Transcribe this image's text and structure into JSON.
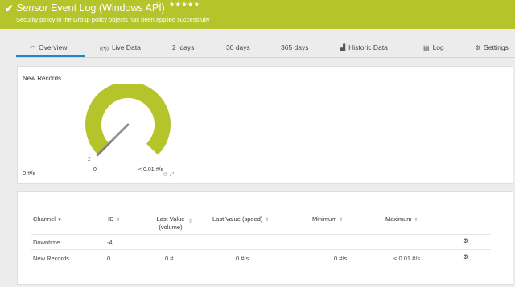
{
  "header": {
    "check_icon": "checkmark-icon",
    "kind": "Sensor",
    "name": "Event Log (Windows API)",
    "flag_icon": "flag-icon",
    "stars": "★★★★★",
    "message": "Security policy in the Group policy objects has been applied successfully",
    "color": "#b4c42a"
  },
  "tabs": [
    {
      "label": "Overview",
      "icon": "overview-gauge-icon",
      "glyph": "◠"
    },
    {
      "label": "Live Data",
      "icon": "live-data-icon",
      "glyph": "((•))"
    },
    {
      "label": "2  days"
    },
    {
      "label": "30 days"
    },
    {
      "label": "365 days"
    },
    {
      "label": "Historic Data",
      "icon": "chart-icon",
      "glyph": "▟"
    },
    {
      "label": "Log",
      "icon": "log-icon",
      "glyph": "▤"
    },
    {
      "label": "Settings",
      "icon": "gear-icon",
      "glyph": "⚙"
    }
  ],
  "active_tab": "Overview",
  "gauge": {
    "title": "New Records",
    "min_label": "0",
    "max_label": "< 0.01 #/s",
    "current_value": "0 #/s",
    "needle_fraction": 0.0,
    "color": "#b4c42a"
  },
  "table": {
    "headers": {
      "channel": "Channel",
      "id": "ID",
      "last_value_volume_1": "Last Value",
      "last_value_volume_2": "(volume)",
      "last_value_speed": "Last Value (speed)",
      "minimum": "Minimum",
      "maximum": "Maximum"
    },
    "rows": [
      {
        "channel": "Downtime",
        "id": "-4",
        "volume": "",
        "speed": "",
        "minimum": "",
        "maximum": ""
      },
      {
        "channel": "New Records",
        "id": "0",
        "volume": "0 #",
        "speed": "0 #/s",
        "minimum": "0 #/s",
        "maximum": "< 0.01 #/s"
      }
    ]
  }
}
